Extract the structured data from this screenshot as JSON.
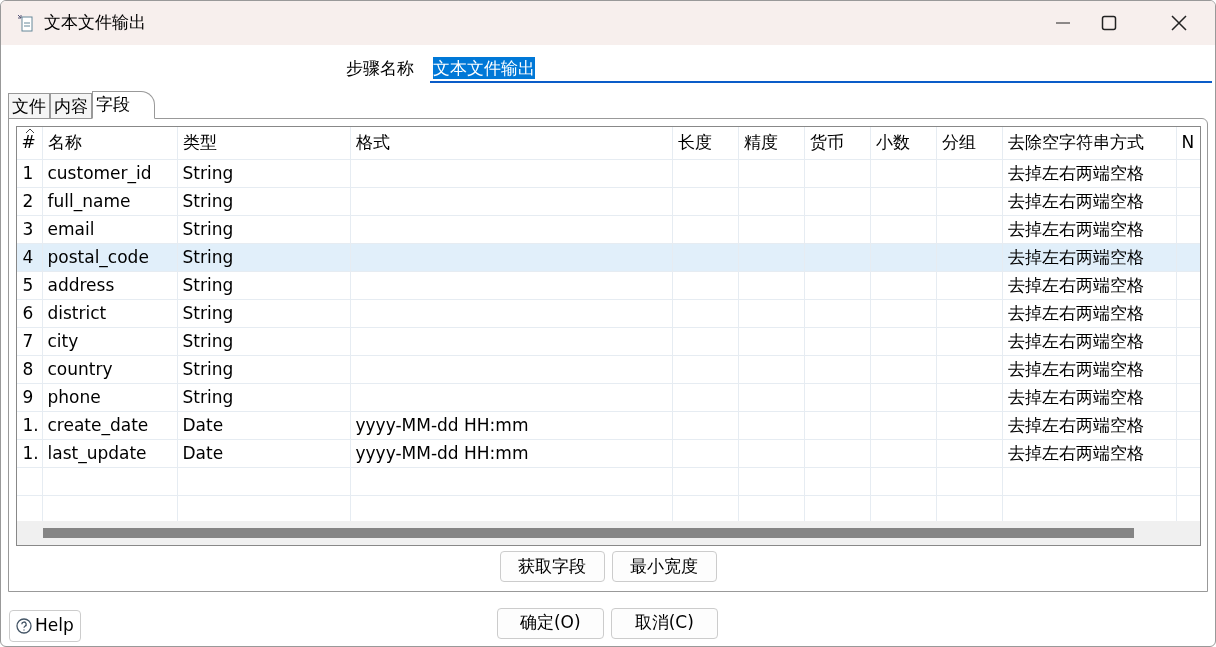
{
  "window": {
    "title": "文本文件输出"
  },
  "step_name": {
    "label": "步骤名称",
    "value": "文本文件输出"
  },
  "tabs": [
    {
      "label": "文件",
      "selected": false
    },
    {
      "label": "内容",
      "selected": false
    },
    {
      "label": "字段",
      "selected": true
    }
  ],
  "table": {
    "columns": [
      "#",
      "名称",
      "类型",
      "格式",
      "长度",
      "精度",
      "货币",
      "小数",
      "分组",
      "去除空字符串方式",
      "N"
    ],
    "rows": [
      {
        "cells": [
          "1",
          "customer_id",
          "String",
          "",
          "",
          "",
          "",
          "",
          "",
          "去掉左右两端空格",
          ""
        ],
        "selected": false
      },
      {
        "cells": [
          "2",
          "full_name",
          "String",
          "",
          "",
          "",
          "",
          "",
          "",
          "去掉左右两端空格",
          ""
        ],
        "selected": false
      },
      {
        "cells": [
          "3",
          "email",
          "String",
          "",
          "",
          "",
          "",
          "",
          "",
          "去掉左右两端空格",
          ""
        ],
        "selected": false
      },
      {
        "cells": [
          "4",
          "postal_code",
          "String",
          "",
          "",
          "",
          "",
          "",
          "",
          "去掉左右两端空格",
          ""
        ],
        "selected": true
      },
      {
        "cells": [
          "5",
          "address",
          "String",
          "",
          "",
          "",
          "",
          "",
          "",
          "去掉左右两端空格",
          ""
        ],
        "selected": false
      },
      {
        "cells": [
          "6",
          "district",
          "String",
          "",
          "",
          "",
          "",
          "",
          "",
          "去掉左右两端空格",
          ""
        ],
        "selected": false
      },
      {
        "cells": [
          "7",
          "city",
          "String",
          "",
          "",
          "",
          "",
          "",
          "",
          "去掉左右两端空格",
          ""
        ],
        "selected": false
      },
      {
        "cells": [
          "8",
          "country",
          "String",
          "",
          "",
          "",
          "",
          "",
          "",
          "去掉左右两端空格",
          ""
        ],
        "selected": false
      },
      {
        "cells": [
          "9",
          "phone",
          "String",
          "",
          "",
          "",
          "",
          "",
          "",
          "去掉左右两端空格",
          ""
        ],
        "selected": false
      },
      {
        "cells": [
          "1.",
          "create_date",
          "Date",
          "yyyy-MM-dd HH:mm",
          "",
          "",
          "",
          "",
          "",
          "去掉左右两端空格",
          ""
        ],
        "selected": false
      },
      {
        "cells": [
          "1.",
          "last_update",
          "Date",
          "yyyy-MM-dd HH:mm",
          "",
          "",
          "",
          "",
          "",
          "去掉左右两端空格",
          ""
        ],
        "selected": false
      }
    ]
  },
  "table_buttons": [
    "获取字段",
    "最小宽度"
  ],
  "help_button": "Help",
  "buttons": [
    "确定(O)",
    "取消(C)"
  ]
}
